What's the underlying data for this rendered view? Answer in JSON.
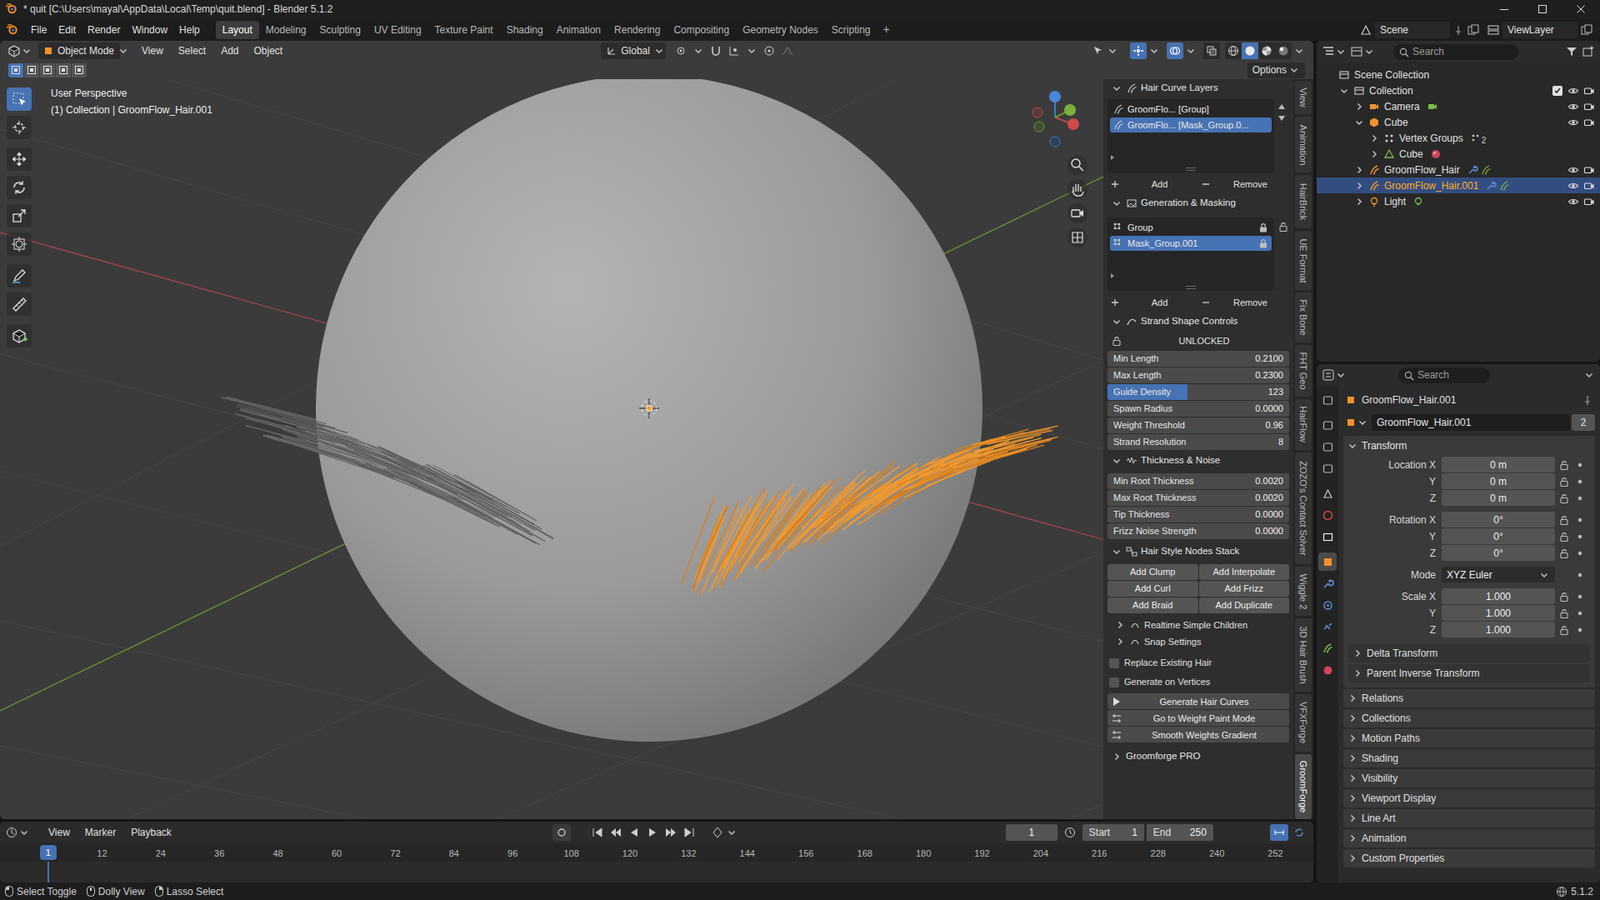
{
  "window": {
    "title": "* quit [C:\\Users\\mayal\\AppData\\Local\\Temp\\quit.blend] - Blender 5.1.2"
  },
  "topbar": {
    "menus": [
      "File",
      "Edit",
      "Render",
      "Window",
      "Help"
    ],
    "workspaces": [
      {
        "label": "Layout",
        "selected": true
      },
      {
        "label": "Modeling",
        "selected": false
      },
      {
        "label": "Sculpting",
        "selected": false
      },
      {
        "label": "UV Editing",
        "selected": false
      },
      {
        "label": "Texture Paint",
        "selected": false
      },
      {
        "label": "Shading",
        "selected": false
      },
      {
        "label": "Animation",
        "selected": false
      },
      {
        "label": "Rendering",
        "selected": false
      },
      {
        "label": "Compositing",
        "selected": false
      },
      {
        "label": "Geometry Nodes",
        "selected": false
      },
      {
        "label": "Scripting",
        "selected": false
      }
    ],
    "add_workspace": "+",
    "scene": "Scene",
    "view_layer": "ViewLayer"
  },
  "viewport": {
    "mode": "Object Mode",
    "menus": [
      "View",
      "Select",
      "Add",
      "Object"
    ],
    "orientation": "Global",
    "options": "Options",
    "select_modes": [
      {
        "selected": true
      },
      {
        "selected": false
      },
      {
        "selected": false
      },
      {
        "selected": false
      },
      {
        "selected": false
      }
    ],
    "toggles": [
      {
        "kind": "gizmos",
        "on": true
      },
      {
        "kind": "overlays",
        "on": true
      },
      {
        "kind": "xray",
        "on": false
      }
    ],
    "shading": [
      {
        "kind": "wireframe",
        "selected": false
      },
      {
        "kind": "solid",
        "selected": true
      },
      {
        "kind": "material",
        "selected": false
      },
      {
        "kind": "rendered",
        "selected": false
      }
    ],
    "info": [
      "User Perspective",
      "(1) Collection | GroomFlow_Hair.001"
    ],
    "tools": [
      {
        "kind": "select",
        "selected": true
      },
      {
        "kind": "cursor",
        "selected": false
      },
      {
        "kind": "move",
        "selected": false
      },
      {
        "kind": "rotate",
        "selected": false
      },
      {
        "kind": "scale",
        "selected": false
      },
      {
        "kind": "transform",
        "selected": false
      },
      {
        "kind": "annotate",
        "selected": false
      },
      {
        "kind": "measure",
        "selected": false
      },
      {
        "kind": "add_cube",
        "selected": false
      }
    ]
  },
  "sidebar": {
    "tabs": [
      {
        "label": "View",
        "selected": false
      },
      {
        "label": "Animation",
        "selected": false
      },
      {
        "label": "HairBrick",
        "selected": false
      },
      {
        "label": "UE Format",
        "selected": false
      },
      {
        "label": "Fix Bone",
        "selected": false
      },
      {
        "label": "FHT Geo",
        "selected": false
      },
      {
        "label": "HairFlow",
        "selected": false
      },
      {
        "label": "ZOZO's Contact Solver",
        "selected": false
      },
      {
        "label": "Wiggle 2",
        "selected": false
      },
      {
        "label": "3D Hair Brush",
        "selected": false
      },
      {
        "label": "VFXForge",
        "selected": false
      },
      {
        "label": "GroomForge",
        "selected": true
      }
    ],
    "layers": {
      "title": "Hair Curve Layers",
      "expanded": true,
      "items": [
        {
          "label": "GroomFlo... [Group]",
          "selected": false
        },
        {
          "label": "GroomFlo... [Mask_Group.0...",
          "selected": true
        }
      ],
      "add": "Add",
      "remove": "Remove"
    },
    "masking": {
      "title": "Generation & Masking",
      "expanded": true,
      "items": [
        {
          "label": "Group",
          "selected": false
        },
        {
          "label": "Mask_Group.001",
          "selected": true
        }
      ],
      "add": "Add",
      "remove": "Remove"
    },
    "strand": {
      "title": "Strand Shape Controls",
      "expanded": true,
      "lock_label": "UNLOCKED",
      "fields": [
        {
          "label": "Min Length",
          "value": "0.2100",
          "kind": "number"
        },
        {
          "label": "Max Length",
          "value": "0.2300",
          "kind": "number"
        },
        {
          "label": "Guide Density",
          "value": "123",
          "kind": "slider",
          "level": 0.44
        },
        {
          "label": "Spawn Radius",
          "value": "0.0000",
          "kind": "number"
        },
        {
          "label": "Weight Threshold",
          "value": "0.96",
          "kind": "number"
        },
        {
          "label": "Strand Resolution",
          "value": "8",
          "kind": "number"
        }
      ]
    },
    "thickness": {
      "title": "Thickness & Noise",
      "expanded": true,
      "fields": [
        {
          "label": "Min Root Thickness",
          "value": "0.0020",
          "kind": "number"
        },
        {
          "label": "Max Root Thickness",
          "value": "0.0020",
          "kind": "number"
        },
        {
          "label": "Tip Thickness",
          "value": "0.0000",
          "kind": "number"
        },
        {
          "label": "Frizz Noise Strength",
          "value": "0.0000",
          "kind": "number"
        }
      ]
    },
    "styles": {
      "title": "Hair Style Nodes Stack",
      "expanded": true,
      "buttons": [
        "Add Clump",
        "Add Interpolate",
        "Add Curl",
        "Add Frizz",
        "Add Braid",
        "Add Duplicate"
      ]
    },
    "subpanels": [
      {
        "title": "Realtime Simple Children",
        "expanded": false
      },
      {
        "title": "Snap Settings",
        "expanded": false
      }
    ],
    "checkboxes": [
      {
        "label": "Replace Existing Hair",
        "checked": false
      },
      {
        "label": "Generate on Vertices",
        "checked": false
      }
    ],
    "actions": [
      "Generate Hair Curves",
      "Go to Weight Paint Mode",
      "Smooth Weights Gradient"
    ],
    "pro": {
      "title": "Groomforge PRO",
      "expanded": false
    }
  },
  "outliner": {
    "search_placeholder": "Search",
    "items": [
      {
        "label": "Scene Collection",
        "kind": "scene_collection",
        "selected": false,
        "badges": [],
        "children": [
          {
            "label": "Collection",
            "kind": "collection",
            "expanded": true,
            "selected": false,
            "checked": true,
            "visible": true,
            "renderable": true,
            "badges": [],
            "children": [
              {
                "label": "Camera",
                "kind": "camera",
                "expanded": false,
                "selected": false,
                "visible": true,
                "renderable": true,
                "badges": [
                  "camera_data"
                ],
                "children": []
              },
              {
                "label": "Cube",
                "kind": "mesh",
                "expanded": true,
                "selected": false,
                "visible": true,
                "renderable": true,
                "badges": [],
                "children": [
                  {
                    "label": "Vertex Groups",
                    "kind": "vertex_groups",
                    "expanded": false,
                    "selected": false,
                    "badges": [
                      "vertex_group"
                    ],
                    "count": "2",
                    "children": []
                  },
                  {
                    "label": "Cube",
                    "kind": "mesh_data",
                    "expanded": false,
                    "selected": false,
                    "badges": [
                      "material"
                    ],
                    "children": []
                  }
                ]
              },
              {
                "label": "GroomFlow_Hair",
                "kind": "curves",
                "expanded": false,
                "selected": false,
                "visible": true,
                "renderable": true,
                "badges": [
                  "modifier",
                  "curves_data"
                ],
                "children": []
              },
              {
                "label": "GroomFlow_Hair.001",
                "kind": "curves",
                "expanded": false,
                "selected": true,
                "visible": true,
                "renderable": true,
                "badges": [
                  "modifier",
                  "curves_data"
                ],
                "children": []
              },
              {
                "label": "Light",
                "kind": "light",
                "expanded": false,
                "selected": false,
                "visible": true,
                "renderable": true,
                "badges": [
                  "light_data"
                ],
                "children": []
              }
            ]
          }
        ]
      }
    ]
  },
  "properties": {
    "search_placeholder": "Search",
    "tabs": [
      {
        "kind": "tool",
        "color": "#b5b5b5",
        "selected": false
      },
      {
        "kind": "render",
        "color": "#b5b5b5",
        "selected": false
      },
      {
        "kind": "output",
        "color": "#b5b5b5",
        "selected": false
      },
      {
        "kind": "view_layer",
        "color": "#b5b5b5",
        "selected": false
      },
      {
        "kind": "scene",
        "color": "#c8c8c8",
        "selected": false
      },
      {
        "kind": "world",
        "color": "#d0463f",
        "selected": false
      },
      {
        "kind": "collection",
        "color": "#e8e8e8",
        "selected": false
      },
      {
        "kind": "object",
        "color": "#f0922e",
        "selected": true
      },
      {
        "kind": "modifiers",
        "color": "#5d8fd4",
        "selected": false
      },
      {
        "kind": "physics",
        "color": "#5d8fd4",
        "selected": false
      },
      {
        "kind": "constraints",
        "color": "#5d8fd4",
        "selected": false
      },
      {
        "kind": "data",
        "color": "#7dba4a",
        "selected": false
      },
      {
        "kind": "material",
        "color": "#d0465a",
        "selected": false
      }
    ],
    "title": "GroomFlow_Hair.001",
    "datablock": {
      "name": "GroomFlow_Hair.001",
      "users": "2"
    },
    "transform": {
      "title": "Transform",
      "expanded": true,
      "rows": [
        {
          "label": "Location X",
          "value": "0 m",
          "kind": "number"
        },
        {
          "label": "Y",
          "value": "0 m",
          "kind": "number"
        },
        {
          "label": "Z",
          "value": "0 m",
          "kind": "number"
        },
        {
          "label": "Rotation X",
          "value": "0°",
          "kind": "number"
        },
        {
          "label": "Y",
          "value": "0°",
          "kind": "number"
        },
        {
          "label": "Z",
          "value": "0°",
          "kind": "number"
        },
        {
          "label": "Mode",
          "value": "XYZ Euler",
          "kind": "dropdown"
        },
        {
          "label": "Scale X",
          "value": "1.000",
          "kind": "number"
        },
        {
          "label": "Y",
          "value": "1.000",
          "kind": "number"
        },
        {
          "label": "Z",
          "value": "1.000",
          "kind": "number"
        }
      ]
    },
    "subpanels": [
      {
        "title": "Delta Transform",
        "expanded": false
      },
      {
        "title": "Parent Inverse Transform",
        "expanded": false
      }
    ],
    "panels": [
      {
        "title": "Relations",
        "expanded": false
      },
      {
        "title": "Collections",
        "expanded": false
      },
      {
        "title": "Motion Paths",
        "expanded": false
      },
      {
        "title": "Shading",
        "expanded": false
      },
      {
        "title": "Visibility",
        "expanded": false
      },
      {
        "title": "Viewport Display",
        "expanded": false
      },
      {
        "title": "Line Art",
        "expanded": false
      },
      {
        "title": "Animation",
        "expanded": false
      },
      {
        "title": "Custom Properties",
        "expanded": false
      }
    ]
  },
  "timeline": {
    "menus": [
      "View",
      "Marker",
      "Playback"
    ],
    "frame": "1",
    "start_label": "Start",
    "start": "1",
    "end_label": "End",
    "end": "250",
    "playhead": "1",
    "ticks": [
      "12",
      "24",
      "36",
      "48",
      "60",
      "72",
      "84",
      "96",
      "108",
      "120",
      "132",
      "144",
      "156",
      "168",
      "180",
      "192",
      "204",
      "216",
      "228",
      "240",
      "252"
    ]
  },
  "status_bar": {
    "hints": [
      {
        "label": "Select Toggle",
        "kind": "lmb"
      },
      {
        "label": "Dolly View",
        "kind": "mmb"
      },
      {
        "label": "Lasso Select",
        "kind": "rmb"
      }
    ],
    "version": "5.1.2"
  }
}
